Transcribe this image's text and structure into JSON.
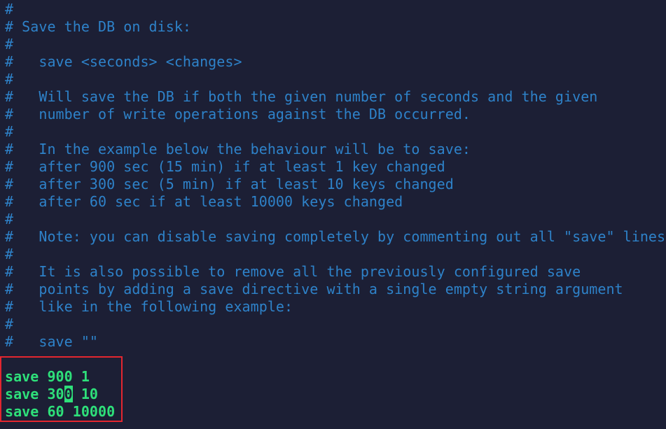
{
  "editor": {
    "comment_lines": [
      "#",
      "# Save the DB on disk:",
      "#",
      "#   save <seconds> <changes>",
      "#",
      "#   Will save the DB if both the given number of seconds and the given",
      "#   number of write operations against the DB occurred.",
      "#",
      "#   In the example below the behaviour will be to save:",
      "#   after 900 sec (15 min) if at least 1 key changed",
      "#   after 300 sec (5 min) if at least 10 keys changed",
      "#   after 60 sec if at least 10000 keys changed",
      "#",
      "#   Note: you can disable saving completely by commenting out all \"save\" lines.",
      "#",
      "#   It is also possible to remove all the previously configured save",
      "#   points by adding a save directive with a single empty string argument",
      "#   like in the following example:",
      "#",
      "#   save \"\"",
      ""
    ],
    "code_lines": {
      "line1": "save 900 1",
      "line2_before_cursor": "save 30",
      "line2_cursor_char": "0",
      "line2_after_cursor": " 10",
      "line3": "save 60 10000"
    }
  },
  "colors": {
    "background": "#1c1f35",
    "comment": "#2e82c9",
    "code": "#2ee07a",
    "highlight_border": "#e3262f"
  }
}
